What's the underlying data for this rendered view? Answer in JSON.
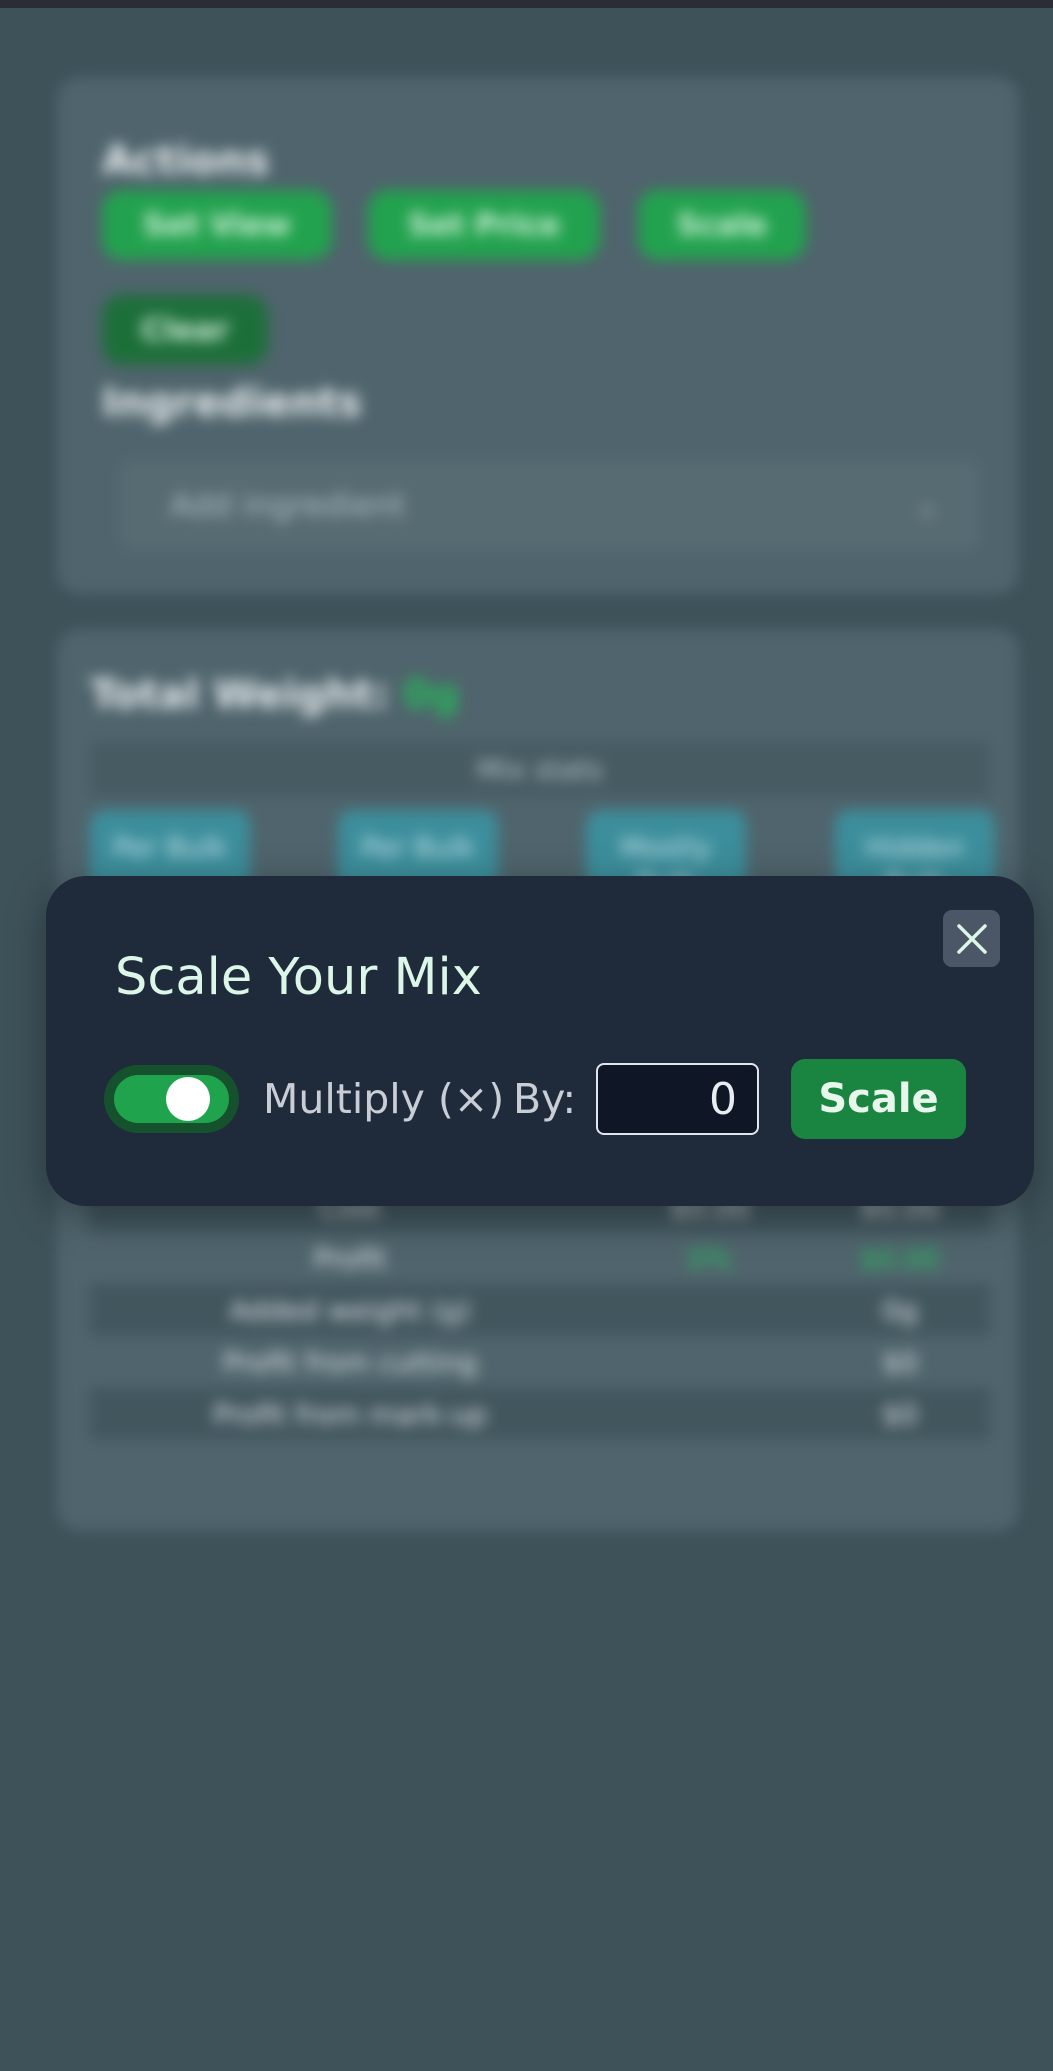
{
  "background": {
    "actions_title": "Actions",
    "buttons": [
      "Set View",
      "Set Price",
      "Scale",
      "Clear"
    ],
    "ingredients_title": "Ingredients",
    "add_ingredient": "Add ingredient",
    "total_weight_label": "Total Weight:",
    "total_weight_value": "0g",
    "mix_header": "Mix stats",
    "tiles": [
      "Per Bulk",
      "Per Bulk",
      "Mostly Bulk",
      "Hidden Bulk"
    ],
    "rows": [
      {
        "label": "Cost",
        "a": "$0.00",
        "b": "$0.00"
      },
      {
        "label": "Profit",
        "a": "0%",
        "b": "$0.00"
      },
      {
        "label": "Added weight (g)",
        "a": "",
        "b": "0g"
      },
      {
        "label": "Profit from cutting",
        "a": "",
        "b": "$0"
      },
      {
        "label": "Profit from mark-up",
        "a": "",
        "b": "$0"
      }
    ]
  },
  "modal": {
    "title": "Scale Your Mix",
    "close_icon": "close-icon",
    "toggle_on": true,
    "multiply_label": "Multiply (×)",
    "by_label": "By:",
    "amount_value": "0",
    "scale_label": "Scale"
  },
  "colors": {
    "accent": "#1a8541",
    "modal_bg": "#1f2a3b",
    "overlay_bg": "#3e525a",
    "title_color": "#dcf6e8"
  }
}
